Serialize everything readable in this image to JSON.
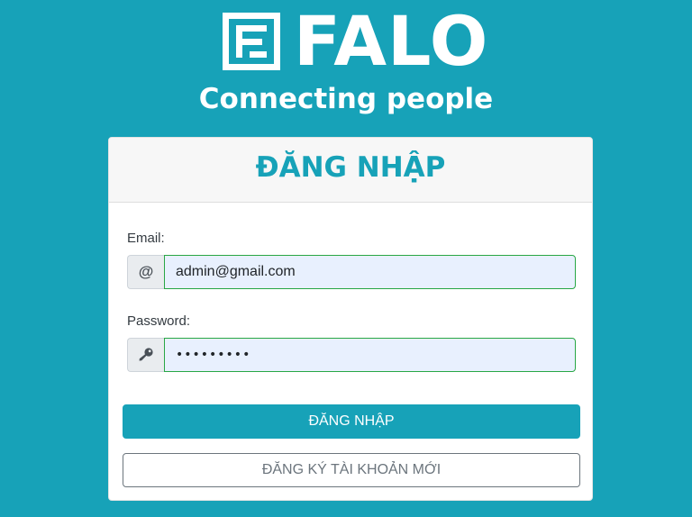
{
  "brand": {
    "name": "FALO",
    "tagline": "Connecting people",
    "logo_icon": "falo-logo-icon"
  },
  "login": {
    "title": "ĐĂNG NHẬP",
    "email_label": "Email:",
    "email_icon": "at-sign-icon",
    "email_value": "admin@gmail.com",
    "password_label": "Password:",
    "password_icon": "key-icon",
    "password_value": "•••••••••",
    "submit_label": "ĐĂNG NHẬP",
    "register_label": "ĐĂNG KÝ TÀI KHOẢN MỚI"
  },
  "colors": {
    "background": "#17a2b8",
    "accent": "#17a2b8",
    "valid_border": "#28a745",
    "input_fill": "#e8f0fe",
    "secondary": "#6c757d"
  }
}
